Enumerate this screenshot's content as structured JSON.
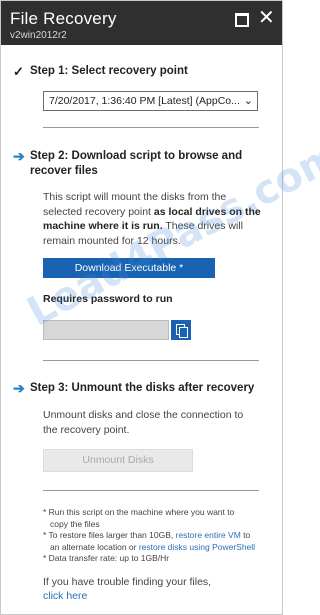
{
  "window": {
    "title": "File Recovery",
    "subtitle": "v2win2012r2"
  },
  "step1": {
    "heading": "Step 1: Select recovery point",
    "recovery_point_value": "7/20/2017, 1:36:40 PM [Latest] (AppCo..."
  },
  "step2": {
    "heading_line1": "Step 2: Download script to browse and",
    "heading_line2": "recover files",
    "desc_line1": "This script will mount the disks from the",
    "desc_line2_pre": "selected recovery point ",
    "desc_line2_bold": "as local drives on the",
    "desc_line3_bold": "machine where it is run.",
    "desc_line3_post": " These drives will",
    "desc_line4": "remain mounted for 12 hours.",
    "download_button": "Download Executable *",
    "password_label": "Requires password to run",
    "password_value": ""
  },
  "step3": {
    "heading": "Step 3: Unmount the disks after recovery",
    "desc_line1": "Unmount disks and close the connection to",
    "desc_line2": "the recovery point.",
    "unmount_button": "Unmount Disks"
  },
  "notes": {
    "n1_line1": "* Run this script on the machine where you want to",
    "n1_line2": "copy the files",
    "n2_line1_pre": "* To restore files larger than 10GB, ",
    "n2_link1": "restore entire VM",
    "n2_line1_post": " to",
    "n2_line2_pre": "an alternate location or ",
    "n2_link2": "restore disks using PowerShell",
    "n3": "* Data transfer rate: up to 1GB/Hr"
  },
  "footer": {
    "trouble_text": "If you have trouble finding your files,",
    "click_here": "click here"
  },
  "watermark": "Lead4Pass.com",
  "colors": {
    "titlebar": "#2f2f2f",
    "primary_button": "#1a63b3",
    "arrow": "#2a84c6",
    "link": "#2a6fb8"
  }
}
